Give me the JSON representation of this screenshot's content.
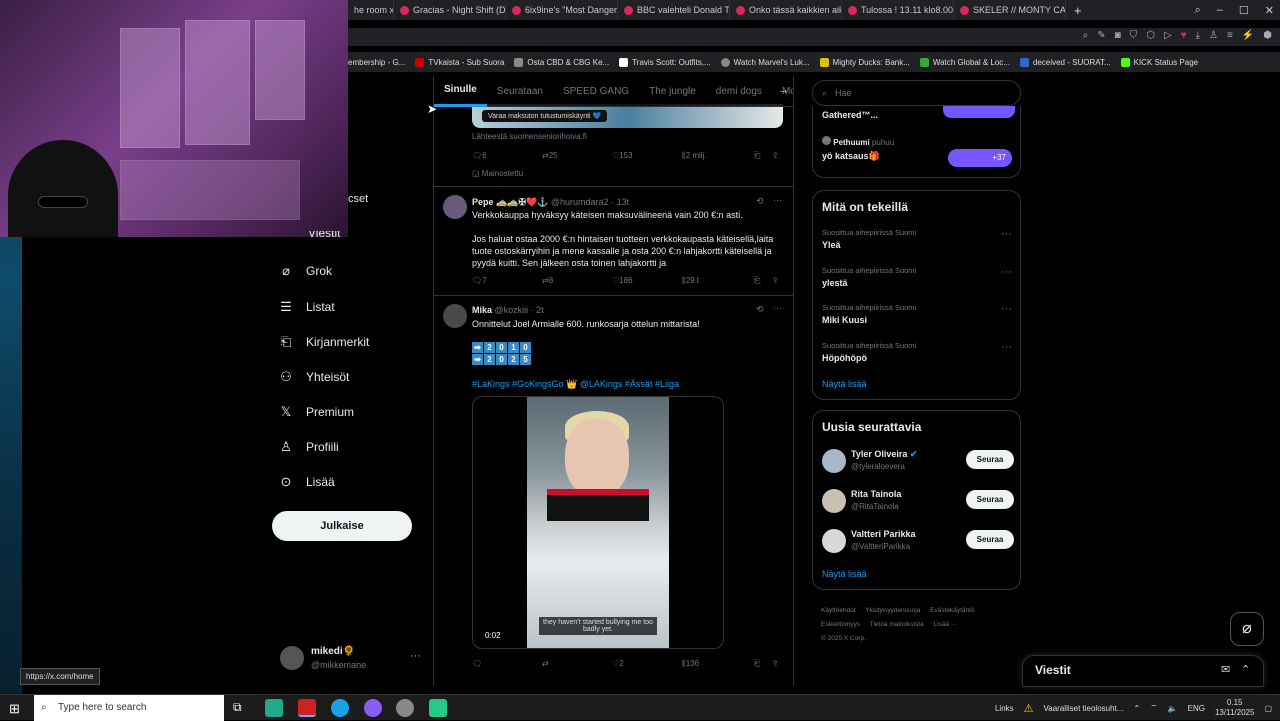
{
  "browser": {
    "tabs": [
      {
        "title": "he room x"
      },
      {
        "title": "Gracias - Night Shift (DJ K"
      },
      {
        "title": "6ix9ine's \"Most Dangerous"
      },
      {
        "title": "BBC valehteli Donald Trum"
      },
      {
        "title": "Onko tässä kaikkien aikoje"
      },
      {
        "title": "Tulossa ! 13.11 klo8.00 Cla"
      },
      {
        "title": "SKELER // MONTY CARLO"
      }
    ],
    "bookmarks": [
      {
        "label": "embership - G..."
      },
      {
        "label": "TVkaista - Sub Suora"
      },
      {
        "label": "Osta CBD & CBG Ke..."
      },
      {
        "label": "Travis Scott: Outfits,..."
      },
      {
        "label": "Watch Marvel's Luk..."
      },
      {
        "label": "Mighty Ducks: Bank..."
      },
      {
        "label": "Watch Global & Loc..."
      },
      {
        "label": "deceived - SUORAT..."
      },
      {
        "label": "KICK Status Page"
      }
    ],
    "status_url": "https://x.com/home"
  },
  "sidebar": {
    "partial_top": "cset",
    "partial_item": "Viestit",
    "items": [
      {
        "label": "Grok",
        "icon": "grok-icon"
      },
      {
        "label": "Listat",
        "icon": "list-icon"
      },
      {
        "label": "Kirjanmerkit",
        "icon": "bookmark-icon"
      },
      {
        "label": "Yhteisöt",
        "icon": "communities-icon"
      },
      {
        "label": "Premium",
        "icon": "x-logo-icon"
      },
      {
        "label": "Profiili",
        "icon": "profile-icon"
      },
      {
        "label": "Lisää",
        "icon": "more-icon"
      }
    ],
    "post_button": "Julkaise",
    "account": {
      "name": "mikedi🌻",
      "handle": "@mikkemane"
    }
  },
  "feed": {
    "tabs": [
      "Sinulle",
      "Seurataan",
      "SPEED GANG",
      "The jungle",
      "demi dogs",
      "Mc"
    ],
    "active_tab": "Sinulle",
    "ad": {
      "badge": "Varaa maksuton tutustumiskäynti 💙",
      "source": "Lähteestä suomenseniorihoiva.fi",
      "replies": "6",
      "reposts": "25",
      "likes": "153",
      "views": "2 milj.",
      "promoted": "Mainostettu"
    },
    "tweets": [
      {
        "name": "Pepe 🚕🚕✠❤️⚓",
        "handle": "@hurumdara2",
        "time": "· 13t",
        "text1": "Verkkokauppa hyväksyy käteisen maksuvälineenä vain 200 €:n asti.",
        "text2": "Jos haluat ostaa 2000 €:n hintaisen tuotteen verkkokaupasta käteisellä,laita tuote ostoskärryihin ja mene kassalle ja osta 200 €:n lahjakortti käteisellä ja pyydä kuitti. Sen jälkeen osta toinen lahjakortti ja",
        "replies": "7",
        "reposts": "8",
        "likes": "186",
        "views": "29 t"
      },
      {
        "name": "Mika",
        "handle": "@kozkiii",
        "time": "· 2t",
        "text1": "Onnittelut Joel Armialle 600. runkosarja ottelun mittarista!",
        "emoji_row1": [
          "➡",
          "2",
          "0",
          "1",
          "0"
        ],
        "emoji_row2": [
          "➡",
          "2",
          "0",
          "2",
          "5"
        ],
        "hashtags": "#LaKings #GoKingsGo 👑 @LAKings #Ässät #Liiga",
        "video_caption": "they haven't started bullying me too badly yet.",
        "video_time": "0:02",
        "replies": "",
        "reposts": "",
        "likes": "2",
        "views": "136"
      }
    ]
  },
  "right": {
    "search_placeholder": "Hae",
    "top_box": {
      "item1": "Gathered™...",
      "live_user": "Pethuumi",
      "live_label": "puhuu",
      "item2": "yö katsaus🎁",
      "count": "+37"
    },
    "trends": {
      "title": "Mitä on tekeillä",
      "items": [
        {
          "context": "Suosittua aihepiirissä Suomi",
          "name": "Yleä"
        },
        {
          "context": "Suosittua aihepiirissä Suomi",
          "name": "ylestä"
        },
        {
          "context": "Suosittua aihepiirissä Suomi",
          "name": "Miki Kuusi"
        },
        {
          "context": "Suosittua aihepiirissä Suomi",
          "name": "Höpöhöpö"
        }
      ],
      "show_more": "Näytä lisää"
    },
    "who_to_follow": {
      "title": "Uusia seurattavia",
      "users": [
        {
          "name": "Tyler Oliveira",
          "handle": "@tyleraloevera",
          "verified": true,
          "button": "Seuraa"
        },
        {
          "name": "Rita Tainola",
          "handle": "@RitaTainola",
          "verified": false,
          "button": "Seuraa"
        },
        {
          "name": "Valtteri Parikka",
          "handle": "@ValtteriParikka",
          "verified": false,
          "button": "Seuraa"
        }
      ],
      "show_more": "Näytä lisää"
    },
    "footer": [
      "Käyttöehdot",
      "Yksityisyydensuoja",
      "Evästekäytäntö",
      "Esteettömyys",
      "Tietoa mainoksista",
      "Lisää ···",
      "© 2025 X Corp."
    ]
  },
  "messages": {
    "title": "Viestit"
  },
  "taskbar": {
    "search_placeholder": "Type here to search",
    "links": "Links",
    "warning": "Vaaralliset tieolosuht...",
    "lang": "ENG",
    "time": "0.15",
    "date": "13/11/2025"
  },
  "colors": {
    "accent": "#1d9bf0",
    "background": "#000000",
    "text": "#e7e9ea",
    "muted": "#71767b",
    "border": "#2f3336"
  }
}
